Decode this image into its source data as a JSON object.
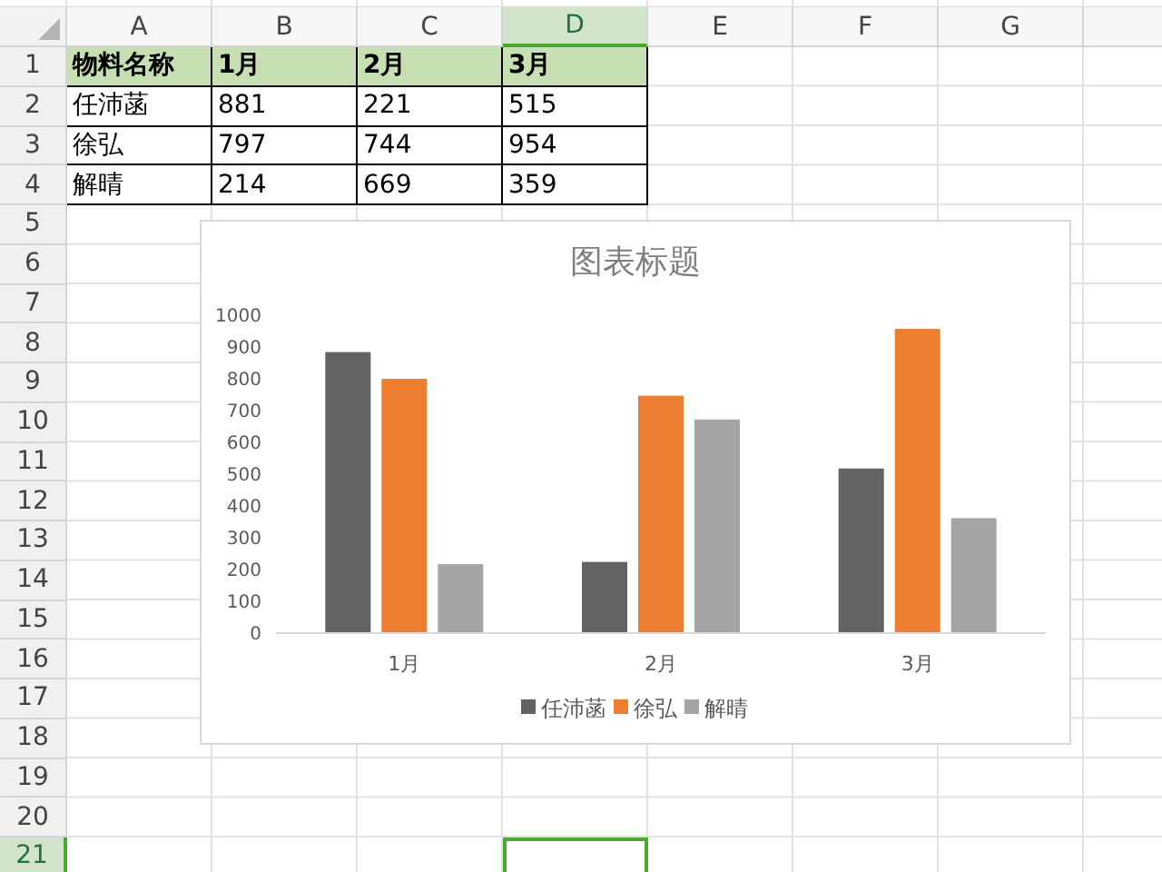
{
  "columns": [
    {
      "label": "A",
      "selected": false
    },
    {
      "label": "B",
      "selected": false
    },
    {
      "label": "C",
      "selected": false
    },
    {
      "label": "D",
      "selected": true
    },
    {
      "label": "E",
      "selected": false
    },
    {
      "label": "F",
      "selected": false
    },
    {
      "label": "G",
      "selected": false
    }
  ],
  "rows": [
    {
      "label": "1",
      "selected": false,
      "cells": [
        "物料名称",
        "1月",
        "2月",
        "3月"
      ],
      "header": true
    },
    {
      "label": "2",
      "selected": false,
      "cells": [
        "任沛菡",
        "881",
        "221",
        "515"
      ],
      "header": false
    },
    {
      "label": "3",
      "selected": false,
      "cells": [
        "徐弘",
        "797",
        "744",
        "954"
      ],
      "header": false
    },
    {
      "label": "4",
      "selected": false,
      "cells": [
        "解晴",
        "214",
        "669",
        "359"
      ],
      "header": false
    },
    {
      "label": "5",
      "selected": false
    },
    {
      "label": "6",
      "selected": false
    },
    {
      "label": "7",
      "selected": false
    },
    {
      "label": "8",
      "selected": false
    },
    {
      "label": "9",
      "selected": false
    },
    {
      "label": "10",
      "selected": false
    },
    {
      "label": "11",
      "selected": false
    },
    {
      "label": "12",
      "selected": false
    },
    {
      "label": "13",
      "selected": false
    },
    {
      "label": "14",
      "selected": false
    },
    {
      "label": "15",
      "selected": false
    },
    {
      "label": "16",
      "selected": false
    },
    {
      "label": "17",
      "selected": false
    },
    {
      "label": "18",
      "selected": false
    },
    {
      "label": "19",
      "selected": false
    },
    {
      "label": "20",
      "selected": false
    },
    {
      "label": "21",
      "selected": true
    }
  ],
  "chart": {
    "chart_data": {
      "type": "bar",
      "title": "图表标题",
      "legend": "bottom",
      "categories": [
        "1月",
        "2月",
        "3月"
      ],
      "ylim": [
        0,
        1000
      ],
      "yticks": [
        0,
        100,
        200,
        300,
        400,
        500,
        600,
        700,
        800,
        900,
        1000
      ],
      "series": [
        {
          "name": "任沛菡",
          "color": "#636461",
          "values": [
            881,
            221,
            515
          ]
        },
        {
          "name": "徐弘",
          "color": "#ed7d31",
          "values": [
            797,
            744,
            954
          ]
        },
        {
          "name": "解晴",
          "color": "#a5a5a5",
          "values": [
            214,
            669,
            359
          ]
        }
      ]
    }
  }
}
